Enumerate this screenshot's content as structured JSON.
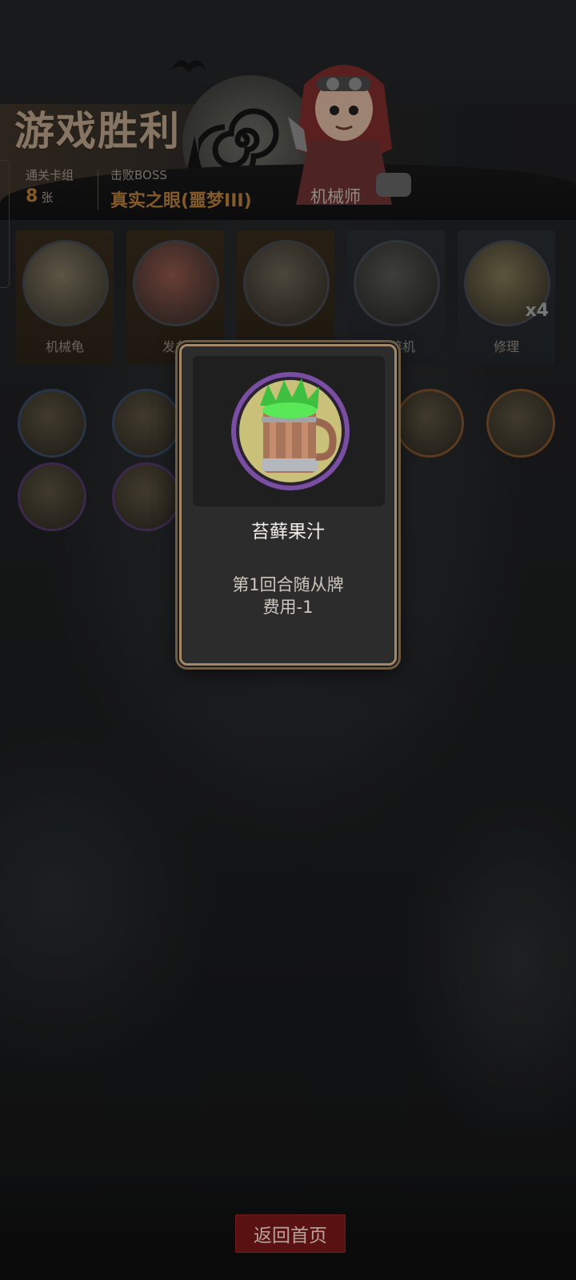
{
  "header": {
    "title": "游戏胜利",
    "deck_label": "通关卡组",
    "deck_count": "8",
    "deck_unit": "张",
    "boss_label": "击败BOSS",
    "boss_name": "真实之眼(噩梦III)",
    "character_name": "机械师"
  },
  "cards": [
    {
      "label": "机械龟",
      "theme": "warm"
    },
    {
      "label": "发条"
    },
    {
      "label": ""
    },
    {
      "label": "粉碎机",
      "theme": "cool"
    },
    {
      "label": "修理",
      "theme": "cool",
      "multiplier": "x4"
    }
  ],
  "relics": [
    {
      "icon": "fire-claw-icon",
      "ring": "blue"
    },
    {
      "icon": "cocktail-icon",
      "ring": "blue"
    },
    {
      "icon": "spellbook-icon",
      "ring": "orange"
    },
    {
      "icon": "wizard-icon",
      "ring": "orange"
    },
    {
      "icon": "spider-robot-icon",
      "ring": "purple"
    },
    {
      "icon": "treasure-bag-icon",
      "ring": "purple"
    }
  ],
  "modal": {
    "item_icon": "moss-juice-mug-icon",
    "item_name": "苔藓果汁",
    "desc_line1": "第1回合随从牌",
    "desc_line2": "费用-1"
  },
  "footer": {
    "home_button": "返回首页"
  },
  "colors": {
    "title": "#9e8a74",
    "accent_gold": "#9b6a2f",
    "modal_border": "#a48968",
    "home_button_bg": "#5a1111",
    "relic_ring_purple": "#7a4ea3"
  }
}
